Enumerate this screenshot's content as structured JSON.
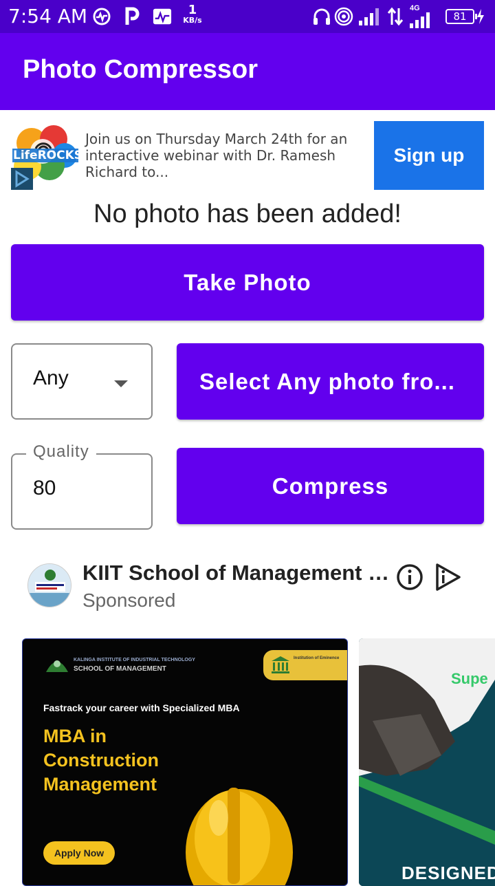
{
  "status_bar": {
    "time": "7:54 AM",
    "net_speed_value": "1",
    "net_speed_unit": "KB/s",
    "network_type": "4G",
    "battery": "81"
  },
  "app_bar": {
    "title": "Photo Compressor"
  },
  "top_ad": {
    "brand": "LifeROCKS",
    "copy": "Join us on Thursday March 24th for an interactive webinar with Dr. Ramesh Richard to...",
    "cta": "Sign up"
  },
  "main": {
    "empty_message": "No photo has been added!",
    "take_photo_label": "Take Photo",
    "source_dropdown_value": "Any",
    "select_photo_label": "Select Any photo fro...",
    "quality_label": "Quality",
    "quality_value": "80",
    "compress_label": "Compress"
  },
  "bottom_ad": {
    "advertiser": "KIIT School of Management -...",
    "sponsored": "Sponsored",
    "card1": {
      "school": "KALINGA INSTITUTE OF INDUSTRIAL TECHNOLOGY",
      "school_sub": "SCHOOL OF MANAGEMENT",
      "eminence": "Institution of Eminence",
      "tagline": "Fastrack your career with Specialized MBA",
      "headline_1": "MBA in",
      "headline_2": "Construction",
      "headline_3": "Management",
      "cta": "Apply Now"
    },
    "card2": {
      "heading": "Supe",
      "footer": "DESIGNED"
    }
  },
  "colors": {
    "status_bar": "#4a00c9",
    "primary": "#6200ee",
    "ad_cta": "#1a73e8",
    "accent_yellow": "#f4c21f"
  }
}
